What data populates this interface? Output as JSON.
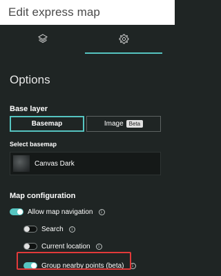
{
  "header": {
    "title": "Edit express map"
  },
  "tabs": [
    {
      "icon": "layers-icon",
      "active": false
    },
    {
      "icon": "gear-icon",
      "active": true
    }
  ],
  "options": {
    "title": "Options"
  },
  "base_layer": {
    "label": "Base layer",
    "segments": {
      "basemap": "Basemap",
      "image": "Image",
      "beta": "Beta"
    },
    "selected": "Basemap"
  },
  "select_basemap": {
    "label": "Select basemap",
    "value": "Canvas Dark"
  },
  "map_configuration": {
    "label": "Map configuration",
    "items": [
      {
        "label": "Allow map navigation",
        "on": true
      },
      {
        "label": "Search",
        "on": false
      },
      {
        "label": "Current location",
        "on": false
      },
      {
        "label": "Group nearby points (beta)",
        "on": true
      }
    ]
  },
  "colors": {
    "accent": "#56c5c1",
    "panel": "#1f2524",
    "highlight": "#e23a3a"
  }
}
